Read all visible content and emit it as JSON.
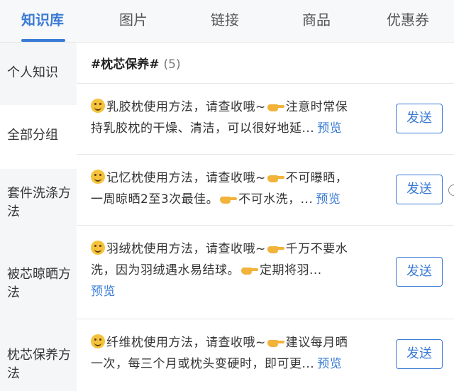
{
  "tabs": [
    {
      "label": "知识库",
      "active": true
    },
    {
      "label": "图片",
      "active": false
    },
    {
      "label": "链接",
      "active": false
    },
    {
      "label": "商品",
      "active": false
    },
    {
      "label": "优惠券",
      "active": false
    }
  ],
  "sidebar": {
    "items": [
      {
        "label": "个人知识",
        "active": false
      },
      {
        "label": "全部分组",
        "active": true
      },
      {
        "label": "套件洗涤方法",
        "active": false
      },
      {
        "label": "被芯晾晒方法",
        "active": false
      },
      {
        "label": "枕芯保养方法",
        "active": false
      }
    ]
  },
  "group": {
    "title": "#枕芯保养#",
    "count": "(5)"
  },
  "cards": [
    {
      "line1": "乳胶枕使用方法，请查收哦~",
      "line1b": "注意时常保",
      "line2": "持乳胶枕的干燥、清洁，可以很好地延...",
      "preview": "预览",
      "send": "发送"
    },
    {
      "line1": "记忆枕使用方法，请查收哦~",
      "line1b": "不可曝晒，",
      "line2": "一周晾晒2至3次最佳。",
      "line2b": "不可水洗，...",
      "preview": "预览",
      "send": "发送"
    },
    {
      "line1": "羽绒枕使用方法，请查收哦~",
      "line1b": "千万不要水",
      "line2": "洗，因为羽绒遇水易结球。",
      "line2b": "定期将羽...",
      "preview": "预览",
      "send": "发送"
    },
    {
      "line1": "纤维枕使用方法，请查收哦~",
      "line1b": "建议每月晒",
      "line2": "一次，每三个月或枕头变硬时，即可更...",
      "preview": "预览",
      "send": "发送"
    }
  ],
  "colors": {
    "accent": "#3a7bd5",
    "sidebar_bg": "#f5f6f8"
  },
  "icons": {
    "emoji": "smiling-face-icon",
    "pointer": "pointing-hand-icon"
  }
}
